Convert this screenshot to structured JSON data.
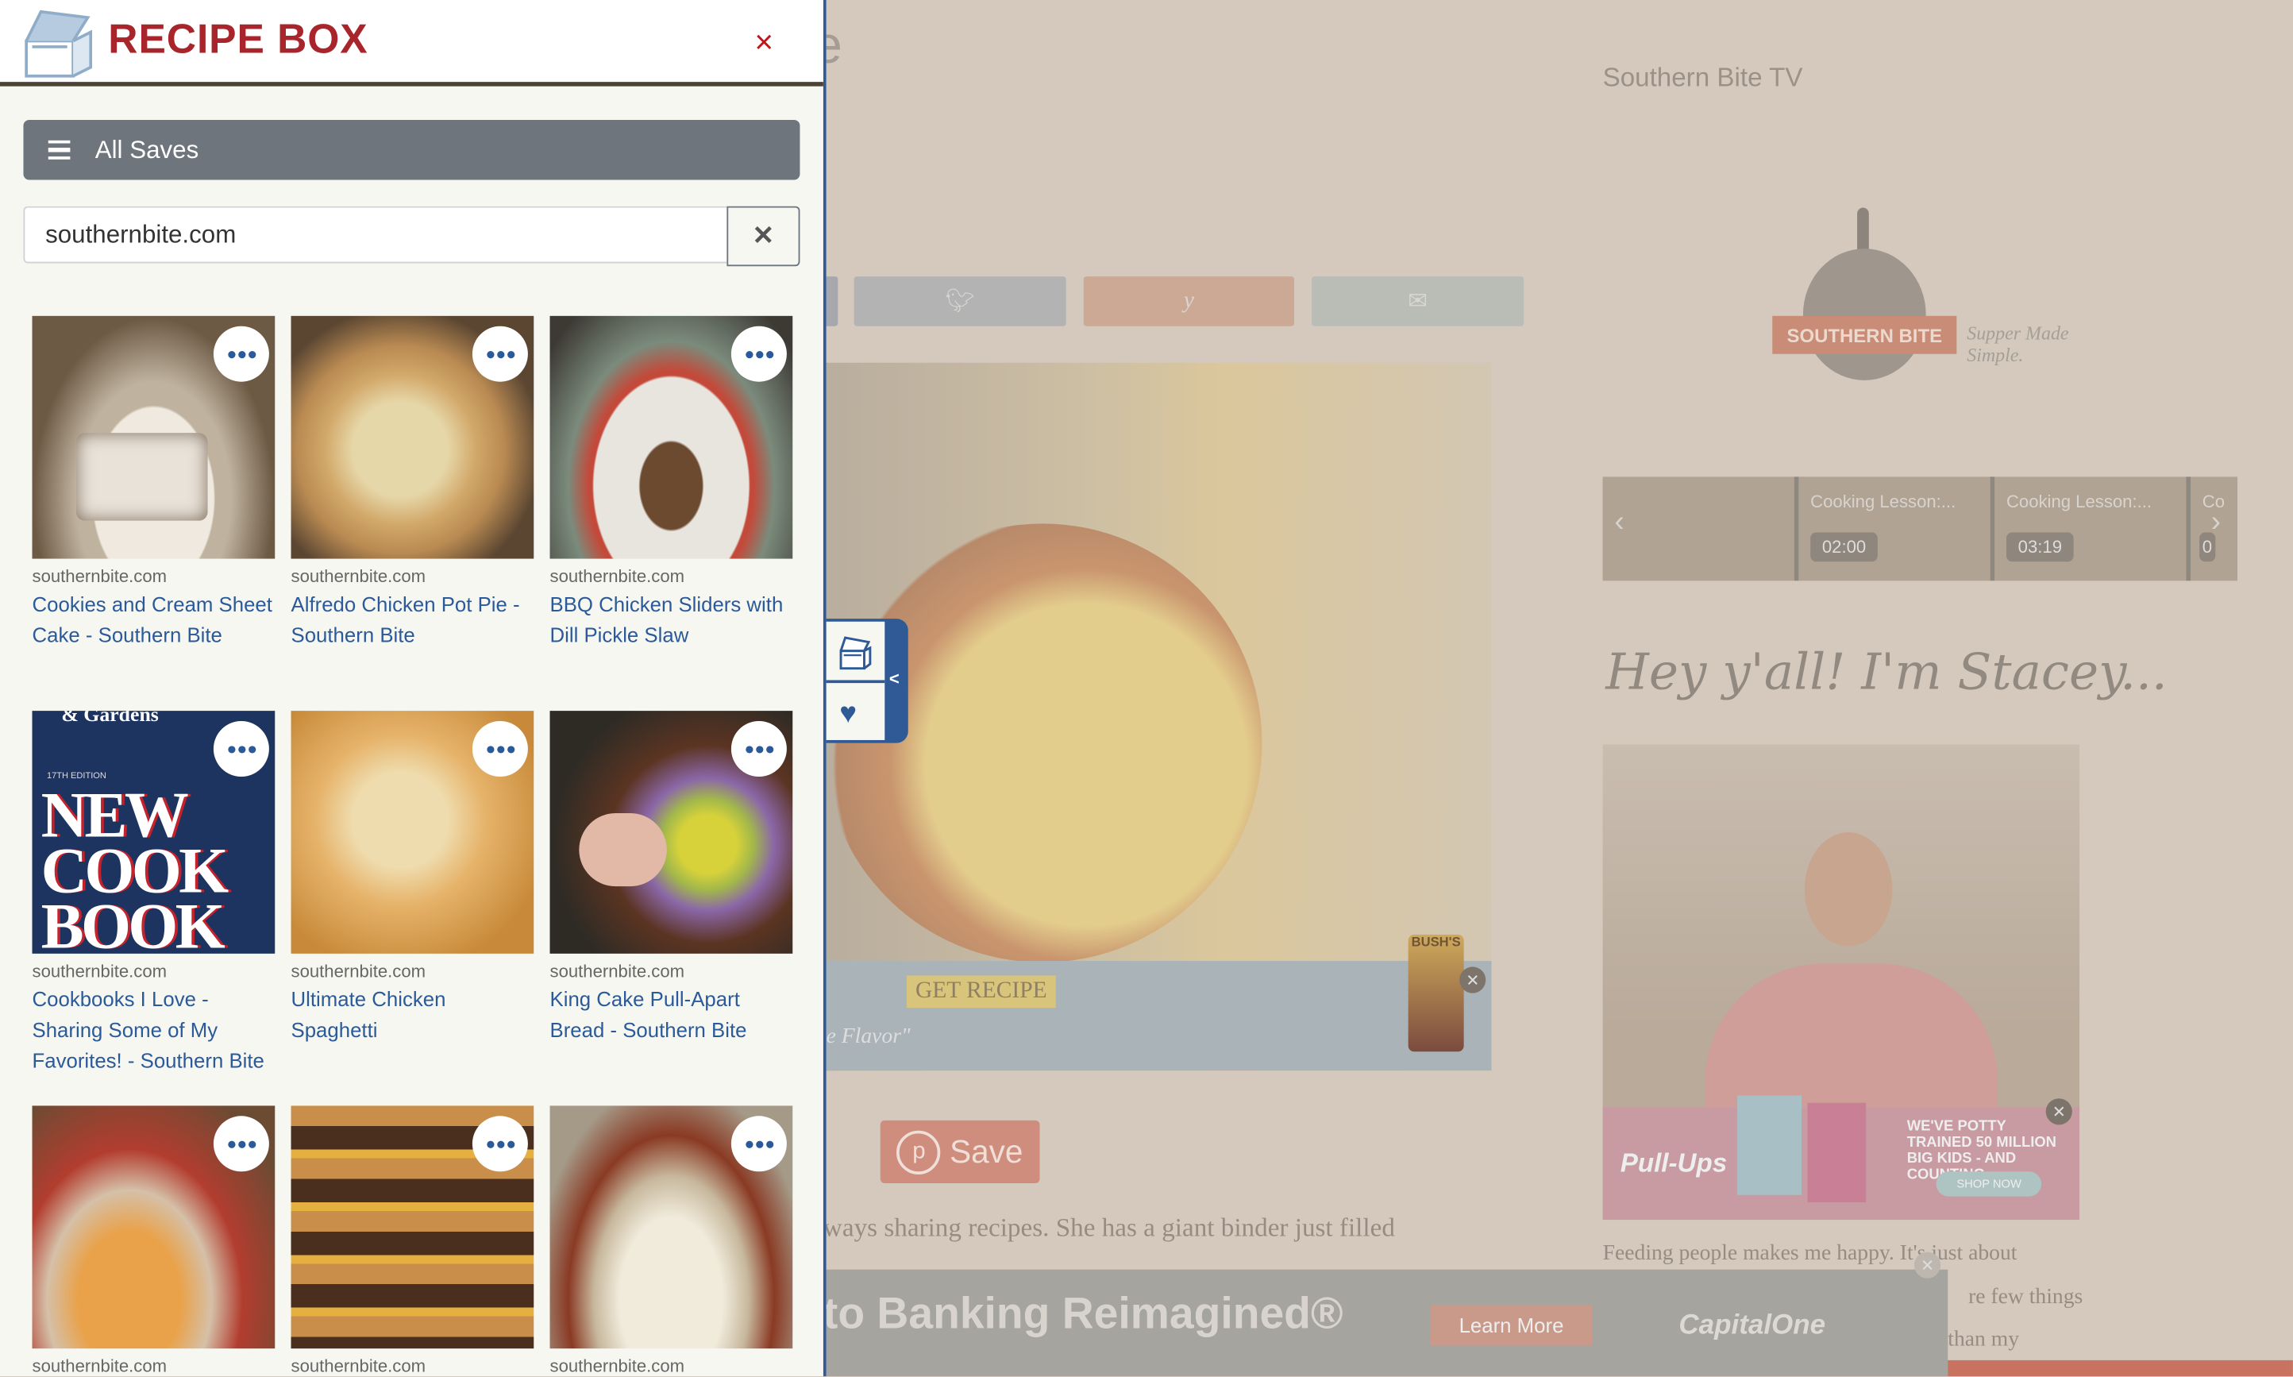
{
  "panel": {
    "brand": "RECIPE BOX",
    "close_label": "×",
    "all_saves_label": "All Saves",
    "search": {
      "value": "southernbite.com",
      "clear_label": "✕"
    },
    "items": [
      {
        "domain": "southernbite.com",
        "title": "Cookies and Cream Sheet Cake - Southern Bite"
      },
      {
        "domain": "southernbite.com",
        "title": "Alfredo Chicken Pot Pie - Southern Bite"
      },
      {
        "domain": "southernbite.com",
        "title": "BBQ Chicken Sliders with Dill Pickle Slaw"
      },
      {
        "domain": "southernbite.com",
        "title": "Cookbooks I Love - Sharing Some of My Favorites! - Southern Bite"
      },
      {
        "domain": "southernbite.com",
        "title": "Ultimate Chicken Spaghetti"
      },
      {
        "domain": "southernbite.com",
        "title": "King Cake Pull-Apart Bread - Southern Bite"
      },
      {
        "domain": "southernbite.com",
        "title": ""
      },
      {
        "domain": "southernbite.com",
        "title": ""
      },
      {
        "domain": "southernbite.com",
        "title": ""
      }
    ],
    "cookbook_cover": {
      "edition": "17TH EDITION",
      "line1": "NEW",
      "line2": "COOK",
      "line3": "BOOK",
      "top": "& Gardens"
    }
  },
  "side_tab": {
    "collapse_label": "<"
  },
  "page": {
    "partial_title": "e",
    "sidebar_title": "Southern Bite TV",
    "logo_text": "SOUTHERN BITE",
    "tagline": "Supper Made Simple.",
    "videos": [
      {
        "title": "",
        "duration": ""
      },
      {
        "title": "Cooking Lesson:...",
        "duration": "02:00"
      },
      {
        "title": "Cooking Lesson:...",
        "duration": "03:19"
      },
      {
        "title": "Co",
        "duration": "0"
      }
    ],
    "greeting": "Hey y'all! I'm Stacey...",
    "pin_save": "Save",
    "body_line": "ways sharing recipes.  She has a giant binder just filled",
    "side_text": [
      "Feeding people makes me happy. It's just about",
      "re few things",
      "than my"
    ],
    "ads": {
      "recipe_ad": {
        "button": "GET RECIPE",
        "brand": "BUSH'S",
        "tag": "e Flavor\""
      },
      "pullups_ad": {
        "brand": "Pull-Ups",
        "headline": "WE'VE POTTY TRAINED 50 MILLION BIG KIDS - AND COUNTING",
        "cta": "SHOP NOW"
      },
      "bank_ad": {
        "headline": "to Banking Reimagined®",
        "cta": "Learn More",
        "brand": "CapitalOne"
      }
    }
  }
}
